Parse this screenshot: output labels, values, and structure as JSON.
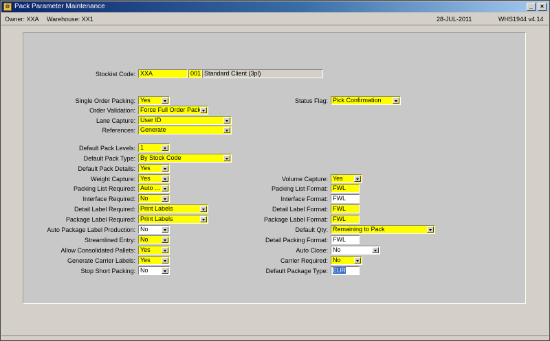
{
  "window": {
    "title": "Pack Parameter Maintenance",
    "owner": "Owner: XXA",
    "warehouse": "Warehouse: XX1",
    "date": "28-JUL-2011",
    "version": "WHS1944 v4.14"
  },
  "form": {
    "stockist_code": {
      "label": "Stockist Code:",
      "code": "XXA",
      "id": "001",
      "name": "Standard Client (3pl)"
    },
    "single_order_packing": {
      "label": "Single Order Packing:",
      "value": "Yes"
    },
    "order_validation": {
      "label": "Order Validation:",
      "value": "Force Full Order Pack"
    },
    "lane_capture": {
      "label": "Lane Capture:",
      "value": "User ID"
    },
    "references": {
      "label": "References:",
      "value": "Generate"
    },
    "status_flag": {
      "label": "Status Flag:",
      "value": "Pick Confirmation"
    },
    "default_pack_levels": {
      "label": "Default Pack Levels:",
      "value": "1"
    },
    "default_pack_type": {
      "label": "Default Pack Type:",
      "value": "By Stock Code"
    },
    "default_pack_details": {
      "label": "Default Pack Details:",
      "value": "Yes"
    },
    "weight_capture": {
      "label": "Weight Capture:",
      "value": "Yes"
    },
    "packing_list_required": {
      "label": "Packing List Required:",
      "value": "Auto ..."
    },
    "interface_required": {
      "label": "Interface Required:",
      "value": "No"
    },
    "detail_label_required": {
      "label": "Detail Label Required:",
      "value": "Print Labels"
    },
    "package_label_required": {
      "label": "Package Label Required:",
      "value": "Print Labels"
    },
    "auto_package_label_production": {
      "label": "Auto Package Label Production:",
      "value": "No"
    },
    "streamlined_entry": {
      "label": "Streamlined Entry:",
      "value": "No"
    },
    "allow_consolidated_pallets": {
      "label": "Allow Consolidated Pallets:",
      "value": "Yes"
    },
    "generate_carrier_labels": {
      "label": "Generate Carrier Labels:",
      "value": "Yes"
    },
    "stop_short_packing": {
      "label": "Stop Short Packing:",
      "value": "No"
    },
    "volume_capture": {
      "label": "Volume Capture:",
      "value": "Yes"
    },
    "packing_list_format": {
      "label": "Packing List Format:",
      "value": "FWL"
    },
    "interface_format": {
      "label": "Interface Format:",
      "value": "FWL"
    },
    "detail_label_format": {
      "label": "Detail Label Format:",
      "value": "FWL"
    },
    "package_label_format": {
      "label": "Package Label Format:",
      "value": "FWL"
    },
    "default_qty": {
      "label": "Default Qty:",
      "value": "Remaining to Pack"
    },
    "detail_packing_format": {
      "label": "Detail Packing Format:",
      "value": "FWL"
    },
    "auto_close": {
      "label": "Auto Close:",
      "value": "No"
    },
    "carrier_required": {
      "label": "Carrier Required:",
      "value": "No"
    },
    "default_package_type": {
      "label": "Default Package Type:",
      "value": "EUR"
    }
  }
}
